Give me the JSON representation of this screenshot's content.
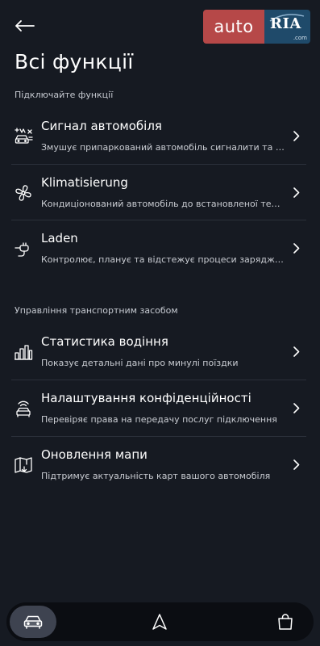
{
  "watermark": {
    "left": "auto",
    "right": "RIA",
    "domain": ".com"
  },
  "page": {
    "title": "Всі функції"
  },
  "sections": [
    {
      "label": "Підключайте функції",
      "items": [
        {
          "icon": "car-alarm-icon",
          "title": "Сигнал автомобіля",
          "description": "Змушує припаркований автомобіль сигналити та блимати фарами"
        },
        {
          "icon": "fan-icon",
          "title": "Klimatisierung",
          "description": "Кондиціонований автомобіль до встановленої температури"
        },
        {
          "icon": "charging-plug-icon",
          "title": "Laden",
          "description": "Контролює, планує та відстежує процеси заряджання"
        }
      ]
    },
    {
      "label": "Управління транспортним засобом",
      "items": [
        {
          "icon": "bar-chart-icon",
          "title": "Статистика водіння",
          "description": "Показує детальні дані про минулі поїздки"
        },
        {
          "icon": "connected-car-icon",
          "title": "Налаштування конфіденційності",
          "description": "Перевіряє права на передачу послуг підключення"
        },
        {
          "icon": "map-update-icon",
          "title": "Оновлення мапи",
          "description": "Підтримує актуальність карт вашого автомобіля"
        }
      ]
    }
  ],
  "bottom_nav": [
    {
      "icon": "car-icon",
      "active": true
    },
    {
      "icon": "navigation-arrow-icon",
      "active": false
    },
    {
      "icon": "shopping-bag-icon",
      "active": false
    }
  ],
  "colors": {
    "background": "#161a22",
    "text": "#ffffff",
    "muted": "#c9ccd2",
    "divider": "#2b303a",
    "nav_bg": "#0b0d12",
    "nav_active": "#3e4350"
  }
}
